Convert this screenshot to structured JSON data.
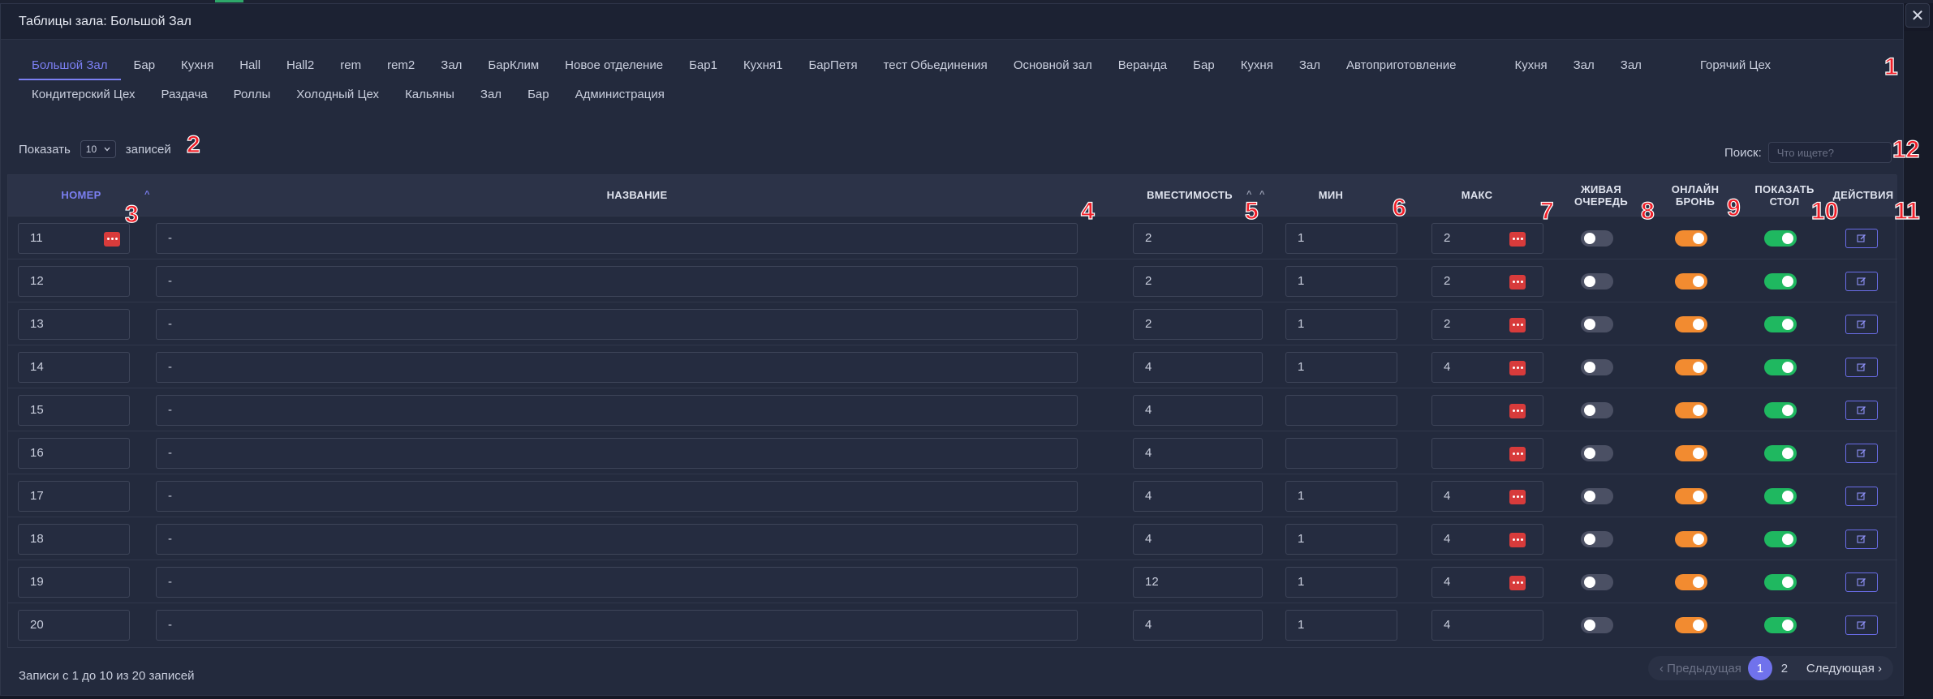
{
  "modal": {
    "title": "Таблицы зала: Большой Зал",
    "close_glyph": "✕"
  },
  "tabs": {
    "row1": [
      "Большой Зал",
      "Бар",
      "Кухня",
      "Hall",
      "Hall2",
      "rem",
      "rem2",
      "Зал",
      "БарКлим",
      "Новое отделение",
      "Бар1",
      "Кухня1",
      "БарПетя",
      "тест Обьединения",
      "Основной зал",
      "Веранда",
      "Бар",
      "Кухня",
      "Зал",
      "Автоприготовление",
      "Кухня",
      "Зал",
      "Зал",
      "Горячий Цех"
    ],
    "row2": [
      "Кондитерский Цех",
      "Раздача",
      "Роллы",
      "Холодный Цех",
      "Кальяны",
      "Зал",
      "Бар",
      "Администрация"
    ],
    "active_index": 0
  },
  "length": {
    "show_label": "Показать",
    "value": "10",
    "records_label": "записей"
  },
  "search": {
    "label": "Поиск:",
    "placeholder": "Что ищете?"
  },
  "columns": {
    "number": "НОМЕР",
    "name": "НАЗВАНИЕ",
    "capacity": "ВМЕСТИМОСТЬ",
    "min": "МИН",
    "max": "МАКС",
    "live_queue": [
      "ЖИВАЯ",
      "ОЧЕРЕДЬ"
    ],
    "online_booking": [
      "ОНЛАЙН",
      "БРОНЬ"
    ],
    "show_table": [
      "ПОКАЗАТЬ",
      "СТОЛ"
    ],
    "actions": "ДЕЙСТВИЯ"
  },
  "rows": [
    {
      "number": "11",
      "name": "-",
      "capacity": "2",
      "min": "1",
      "max": "2",
      "number_dots": true,
      "max_dots": true,
      "live_queue": false,
      "online_booking": true,
      "show_table": true
    },
    {
      "number": "12",
      "name": "-",
      "capacity": "2",
      "min": "1",
      "max": "2",
      "number_dots": false,
      "max_dots": true,
      "live_queue": false,
      "online_booking": true,
      "show_table": true
    },
    {
      "number": "13",
      "name": "-",
      "capacity": "2",
      "min": "1",
      "max": "2",
      "number_dots": false,
      "max_dots": true,
      "live_queue": false,
      "online_booking": true,
      "show_table": true
    },
    {
      "number": "14",
      "name": "-",
      "capacity": "4",
      "min": "1",
      "max": "4",
      "number_dots": false,
      "max_dots": true,
      "live_queue": false,
      "online_booking": true,
      "show_table": true
    },
    {
      "number": "15",
      "name": "-",
      "capacity": "4",
      "min": "",
      "max": "",
      "number_dots": false,
      "max_dots": true,
      "live_queue": false,
      "online_booking": true,
      "show_table": true
    },
    {
      "number": "16",
      "name": "-",
      "capacity": "4",
      "min": "",
      "max": "",
      "number_dots": false,
      "max_dots": true,
      "live_queue": false,
      "online_booking": true,
      "show_table": true
    },
    {
      "number": "17",
      "name": "-",
      "capacity": "4",
      "min": "1",
      "max": "4",
      "number_dots": false,
      "max_dots": true,
      "live_queue": false,
      "online_booking": true,
      "show_table": true
    },
    {
      "number": "18",
      "name": "-",
      "capacity": "4",
      "min": "1",
      "max": "4",
      "number_dots": false,
      "max_dots": true,
      "live_queue": false,
      "online_booking": true,
      "show_table": true
    },
    {
      "number": "19",
      "name": "-",
      "capacity": "12",
      "min": "1",
      "max": "4",
      "number_dots": false,
      "max_dots": true,
      "live_queue": false,
      "online_booking": true,
      "show_table": true
    },
    {
      "number": "20",
      "name": "-",
      "capacity": "4",
      "min": "1",
      "max": "4",
      "number_dots": false,
      "max_dots": false,
      "live_queue": false,
      "online_booking": true,
      "show_table": true
    }
  ],
  "footer": {
    "info": "Записи с 1 до 10 из 20 записей",
    "prev": "Предыдущая",
    "pages": [
      "1",
      "2"
    ],
    "current_page": "1",
    "next": "Следующая"
  },
  "annotations": [
    "1",
    "2",
    "3",
    "4",
    "5",
    "6",
    "7",
    "8",
    "9",
    "10",
    "11",
    "12"
  ],
  "colors": {
    "accent": "#7b7ff2",
    "orange_toggle": "#f28b30",
    "green_toggle": "#1fb860",
    "danger": "#d83b3b",
    "annotation": "#f01e28"
  },
  "icons": {
    "close": "close-icon",
    "sort": "chevron-up-icon",
    "more": "more-dots-icon",
    "edit": "edit-icon",
    "select": "chevron-down-icon",
    "prev": "chevron-left-icon",
    "next": "chevron-right-icon"
  }
}
